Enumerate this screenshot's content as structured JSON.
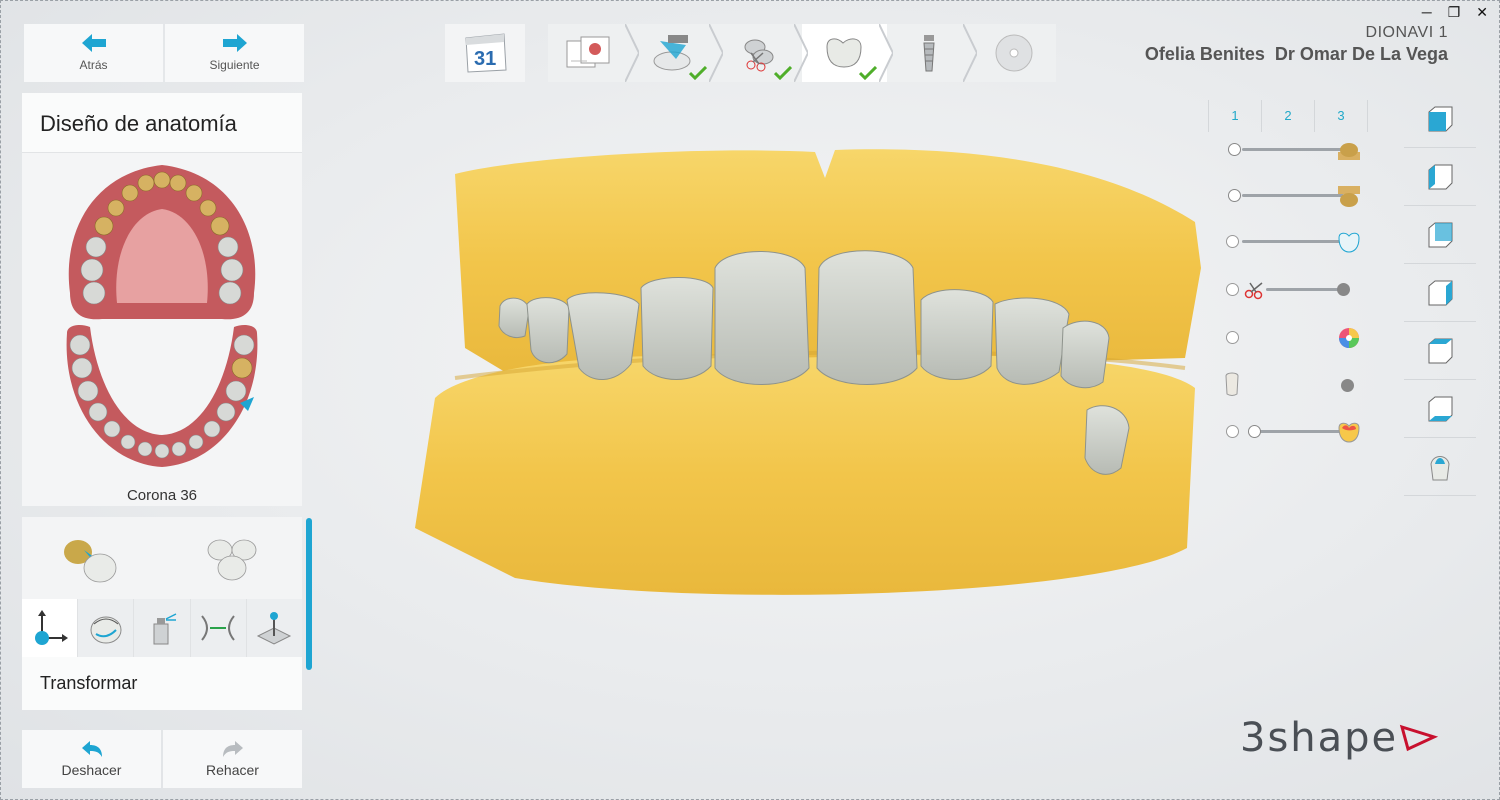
{
  "nav": {
    "back_label": "Atrás",
    "next_label": "Siguiente"
  },
  "panel": {
    "title": "Diseño de anatomía",
    "jaw_caption": "Corona 36"
  },
  "tools": {
    "active_label": "Transformar",
    "tool_icons": [
      "transform-icon",
      "sculpt-icon",
      "spray-icon",
      "contact-icon",
      "place-icon"
    ]
  },
  "history": {
    "undo_label": "Deshacer",
    "redo_label": "Rehacer"
  },
  "calendar": {
    "day": "31"
  },
  "workflow": {
    "steps": [
      {
        "name": "order-form-icon",
        "done": false
      },
      {
        "name": "scan-icon",
        "done": true
      },
      {
        "name": "scissors-icon",
        "done": true
      },
      {
        "name": "crown-icon",
        "done": true
      },
      {
        "name": "implant-icon",
        "done": false
      },
      {
        "name": "disc-icon",
        "done": false
      }
    ]
  },
  "case": {
    "id": "DIONAVI 1",
    "patient": "Ofelia Benites",
    "doctor": "Dr Omar De La Vega"
  },
  "layers": [
    "1",
    "2",
    "3"
  ],
  "visibility": [
    {
      "name": "upper-model-opacity",
      "value": 1.0
    },
    {
      "name": "lower-model-opacity",
      "value": 1.0
    },
    {
      "name": "crown-opacity",
      "value": 1.0
    },
    {
      "name": "clipping-level",
      "value": 1.0
    },
    {
      "name": "color-map",
      "value": 1.0
    },
    {
      "name": "antagonist",
      "value": 1.0
    },
    {
      "name": "distance-map",
      "value": 0.0
    }
  ],
  "view_buttons": [
    "view-front-icon",
    "view-left-icon",
    "view-back-icon",
    "view-right-icon",
    "view-top-icon",
    "view-bottom-icon",
    "view-crown-icon"
  ],
  "logo": {
    "text": "3shape"
  },
  "colors": {
    "accent": "#1ea5d2",
    "model": "#f2c54a",
    "crown": "#c9cdc6",
    "check": "#4fae2a",
    "brand": "#c8102e"
  }
}
